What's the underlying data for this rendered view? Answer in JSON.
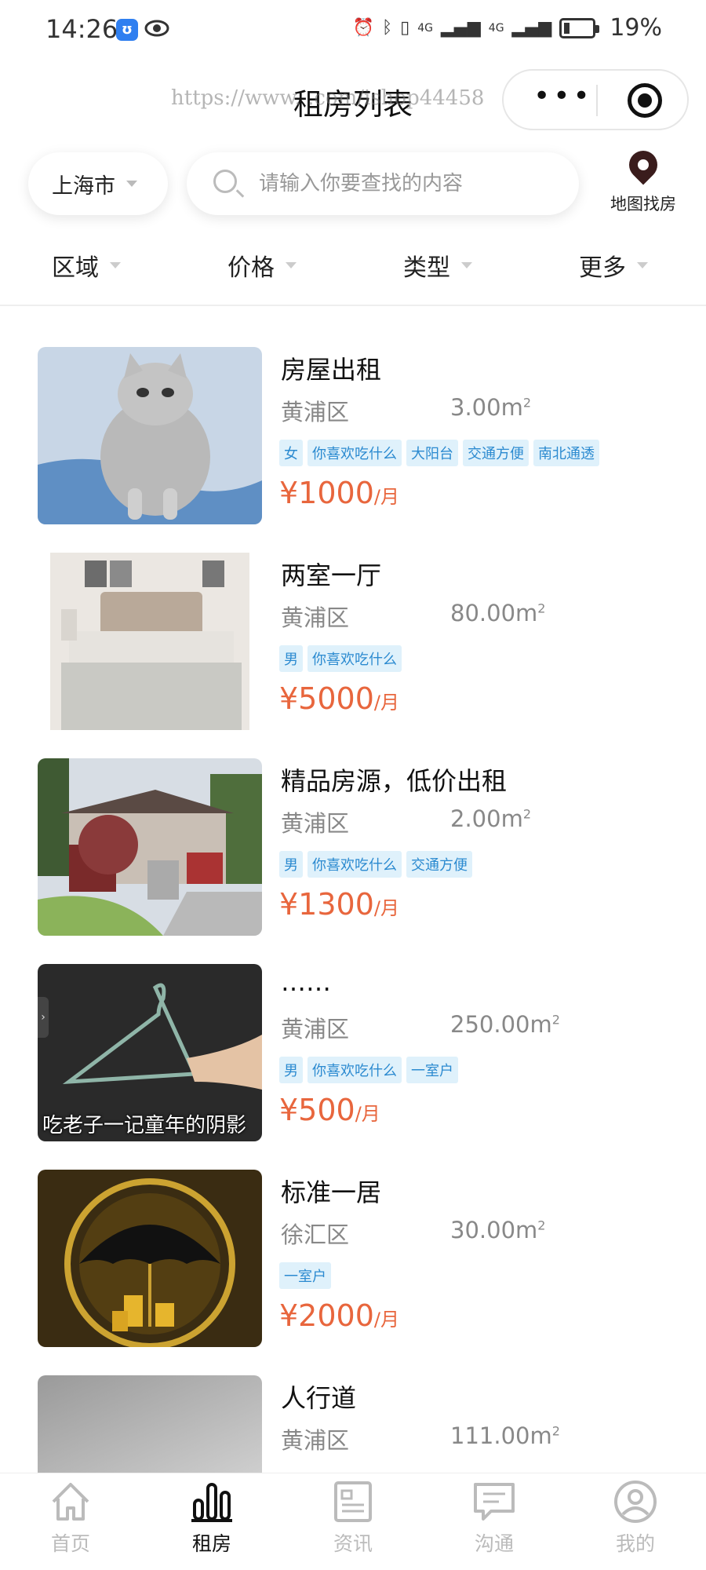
{
  "status_bar": {
    "time": "14:26",
    "network_1": "4G",
    "network_2": "4G",
    "battery": "19%",
    "battery_level": 0.19
  },
  "nav": {
    "title": "租房列表",
    "watermark": "https://www.          .com/ishop44458"
  },
  "search": {
    "city": "上海市",
    "placeholder": "请输入你要查找的内容",
    "map_label": "地图找房"
  },
  "filters": [
    {
      "label": "区域"
    },
    {
      "label": "价格"
    },
    {
      "label": "类型"
    },
    {
      "label": "更多"
    }
  ],
  "listings": [
    {
      "title": "房屋出租",
      "district": "黄浦区",
      "area": "3.00m",
      "tags": [
        "女",
        "你喜欢吃什么",
        "大阳台",
        "交通方便",
        "南北通透"
      ],
      "price": "¥1000",
      "unit": "/月",
      "image": "cat-photo"
    },
    {
      "title": "两室一厅",
      "district": "黄浦区",
      "area": "80.00m",
      "tags": [
        "男",
        "你喜欢吃什么"
      ],
      "price": "¥5000",
      "unit": "/月",
      "image": "bedroom-photo"
    },
    {
      "title": "精品房源，低价出租",
      "district": "黄浦区",
      "area": "2.00m",
      "tags": [
        "男",
        "你喜欢吃什么",
        "交通方便"
      ],
      "price": "¥1300",
      "unit": "/月",
      "image": "house-photo"
    },
    {
      "title": "……",
      "district": "黄浦区",
      "area": "250.00m",
      "tags": [
        "男",
        "你喜欢吃什么",
        "一室户"
      ],
      "price": "¥500",
      "unit": "/月",
      "image": "hanger-photo",
      "caption": "吃老子一记童年的阴影"
    },
    {
      "title": "标准一居",
      "district": "徐汇区",
      "area": "30.00m",
      "tags": [
        "一室户"
      ],
      "price": "¥2000",
      "unit": "/月",
      "image": "umbrella-coins-photo"
    },
    {
      "title": "人行道",
      "district": "黄浦区",
      "area": "111.00m",
      "tags": [],
      "price": "",
      "unit": "",
      "image": "blurred-photo"
    }
  ],
  "area_unit_sup": "2",
  "tabbar": [
    {
      "label": "首页",
      "icon": "home-icon",
      "active": false
    },
    {
      "label": "租房",
      "icon": "bar-chart-icon",
      "active": true
    },
    {
      "label": "资讯",
      "icon": "news-icon",
      "active": false
    },
    {
      "label": "沟通",
      "icon": "chat-icon",
      "active": false
    },
    {
      "label": "我的",
      "icon": "profile-icon",
      "active": false
    }
  ],
  "colors": {
    "price": "#e8663d",
    "tag_bg": "#dff1fb",
    "tag_text": "#2b8ad0",
    "inactive_tab": "#bbbbbb"
  }
}
